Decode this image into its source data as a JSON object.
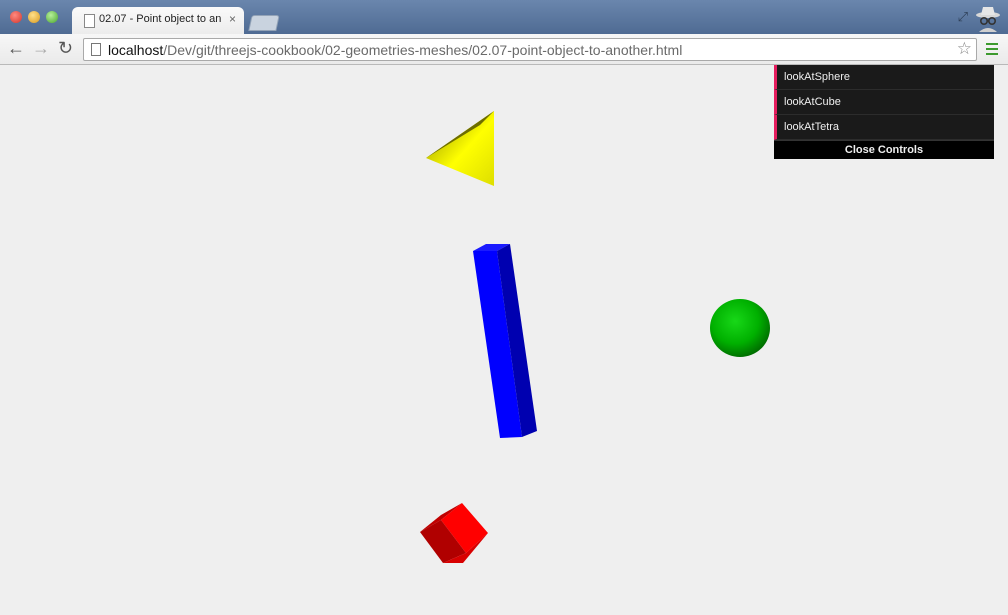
{
  "browser": {
    "tab_title": "02.07 - Point object to an",
    "tab_close": "×",
    "url_host": "localhost",
    "url_path": "/Dev/git/threejs-cookbook/02-geometries-meshes/02.07-point-object-to-another.html"
  },
  "controls": {
    "items": [
      {
        "label": "lookAtSphere"
      },
      {
        "label": "lookAtCube"
      },
      {
        "label": "lookAtTetra"
      }
    ],
    "close_label": "Close Controls"
  },
  "scene": {
    "background": "#efefef",
    "objects": [
      {
        "name": "tetrahedron",
        "color": "#ffff00"
      },
      {
        "name": "long-box",
        "color": "#0000ff"
      },
      {
        "name": "sphere",
        "color": "#00cc00"
      },
      {
        "name": "cube",
        "color": "#ff0000"
      }
    ]
  },
  "colors": {
    "titlebar": "#5a76a0",
    "gui_accent": "#e61d5f",
    "gui_bg": "#1a1a1a"
  }
}
